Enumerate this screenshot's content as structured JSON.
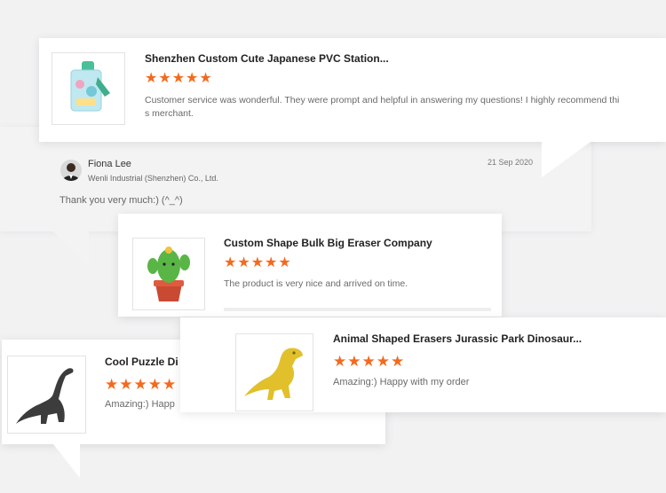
{
  "colors": {
    "star": "#f36a1e",
    "background": "#f2f2f3"
  },
  "review1": {
    "title": "Shenzhen Custom Cute Japanese PVC Station...",
    "stars": 5,
    "text": "Customer service was wonderful. They were prompt and helpful in answering my questions! I highly recommend this merchant.",
    "image": "pvc-stationery-keychain-icon"
  },
  "reply": {
    "name": "Fiona Lee",
    "company": "Wenli Industrial (Shenzhen) Co., Ltd.",
    "date": "21 Sep 2020",
    "text": "Thank you very much:)  (^_^)"
  },
  "review2": {
    "title": "Custom Shape Bulk Big Eraser Company",
    "stars": 5,
    "text": "The product is very nice and arrived on time.",
    "image": "cactus-eraser-icon"
  },
  "review3": {
    "title": "Cool Puzzle Di",
    "stars": 5,
    "text": "Amazing:) Happ",
    "image": "brachiosaurus-eraser-icon"
  },
  "review4": {
    "title": "Animal Shaped Erasers Jurassic Park Dinosaur...",
    "stars": 5,
    "text": "Amazing:) Happy with my order",
    "image": "trex-eraser-icon"
  }
}
